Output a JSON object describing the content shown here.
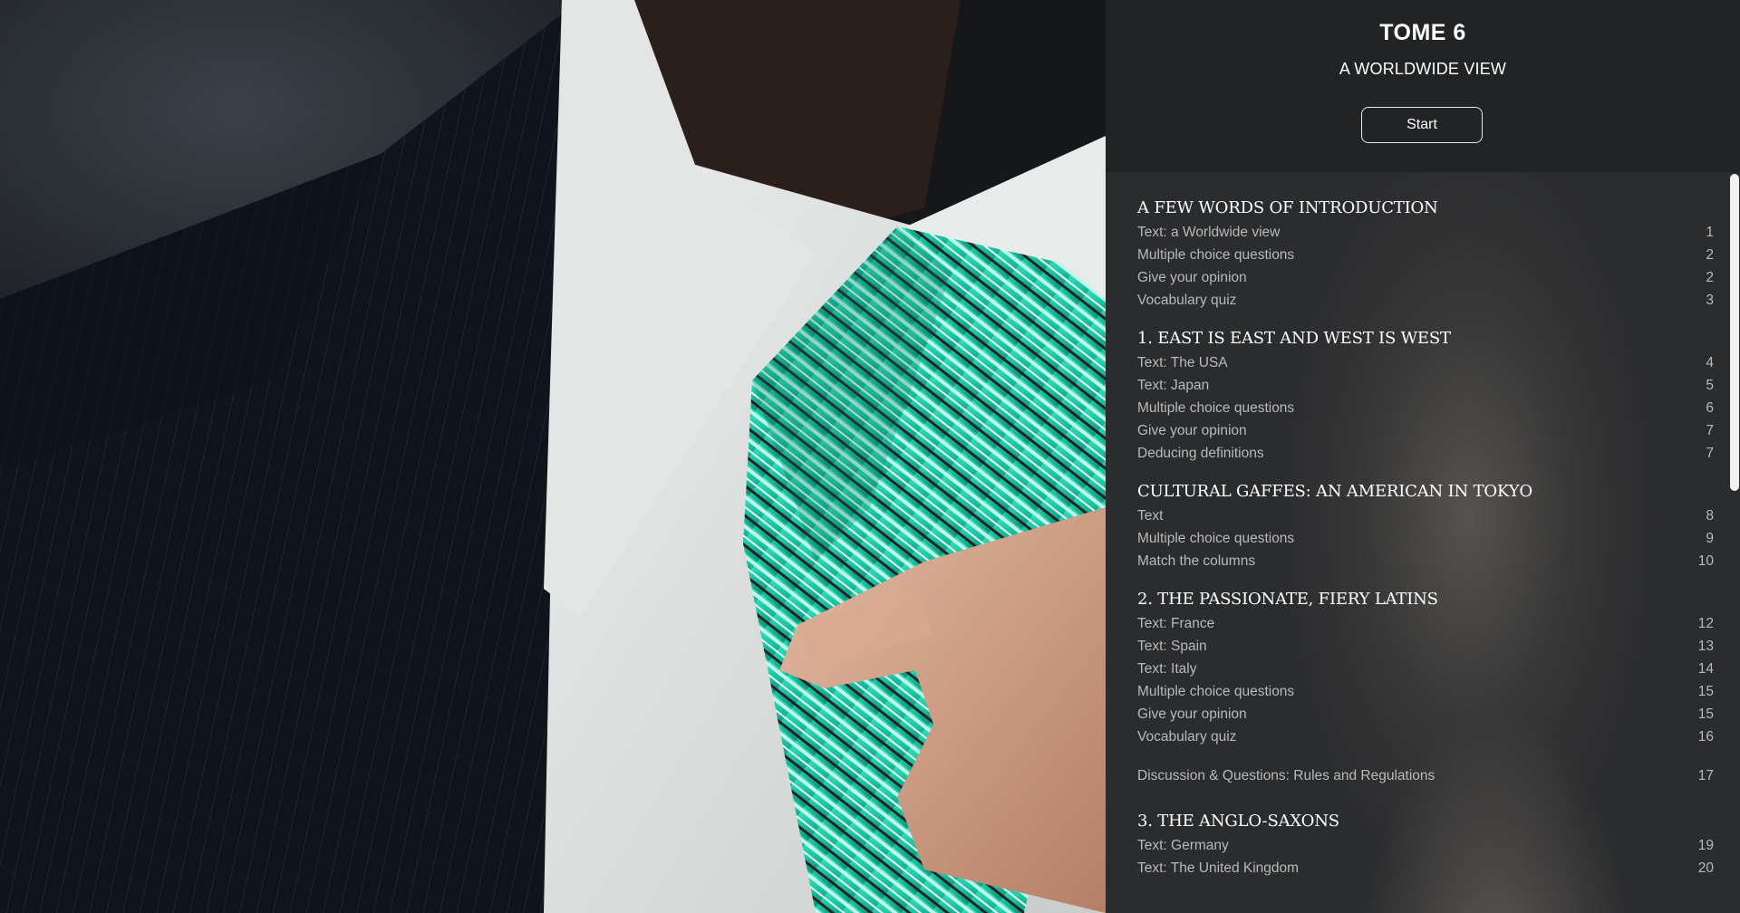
{
  "header": {
    "title": "TOME 6",
    "subtitle": "A WORLDWIDE VIEW",
    "start_label": "Start"
  },
  "toc": {
    "sections": [
      {
        "title": "A FEW WORDS OF INTRODUCTION",
        "entries": [
          {
            "label": "Text: a Worldwide view",
            "page": "1"
          },
          {
            "label": "Multiple choice questions",
            "page": "2"
          },
          {
            "label": "Give your opinion",
            "page": "2"
          },
          {
            "label": "Vocabulary quiz",
            "page": "3"
          }
        ]
      },
      {
        "title": "1. EAST IS EAST AND WEST IS WEST",
        "entries": [
          {
            "label": "Text: The USA",
            "page": "4"
          },
          {
            "label": "Text: Japan",
            "page": "5"
          },
          {
            "label": "Multiple choice questions",
            "page": "6"
          },
          {
            "label": "Give your opinion",
            "page": "7"
          },
          {
            "label": "Deducing definitions",
            "page": "7"
          }
        ]
      },
      {
        "title": "CULTURAL GAFFES: AN AMERICAN IN TOKYO",
        "entries": [
          {
            "label": "Text",
            "page": "8"
          },
          {
            "label": "Multiple choice questions",
            "page": "9"
          },
          {
            "label": "Match the columns",
            "page": "10"
          }
        ]
      },
      {
        "title": "2. THE PASSIONATE, FIERY LATINS",
        "entries": [
          {
            "label": "Text: France",
            "page": "12"
          },
          {
            "label": "Text: Spain",
            "page": "13"
          },
          {
            "label": "Text: Italy",
            "page": "14"
          },
          {
            "label": "Multiple choice questions",
            "page": "15"
          },
          {
            "label": "Give your opinion",
            "page": "15"
          },
          {
            "label": "Vocabulary quiz",
            "page": "16"
          }
        ]
      }
    ],
    "standalone": {
      "label": "Discussion & Questions: Rules and Regulations",
      "page": "17"
    },
    "last_section": {
      "title": "3. THE ANGLO-SAXONS",
      "entries": [
        {
          "label": "Text: Germany",
          "page": "19"
        },
        {
          "label": "Text: The United Kingdom",
          "page": "20"
        }
      ]
    }
  },
  "colors": {
    "panel_bg": "#252628",
    "tie_accent": "#1fc9a7",
    "entry_text": "#b9b9b9"
  },
  "icons": {
    "photo": "businessman-adjusting-tie-image"
  }
}
